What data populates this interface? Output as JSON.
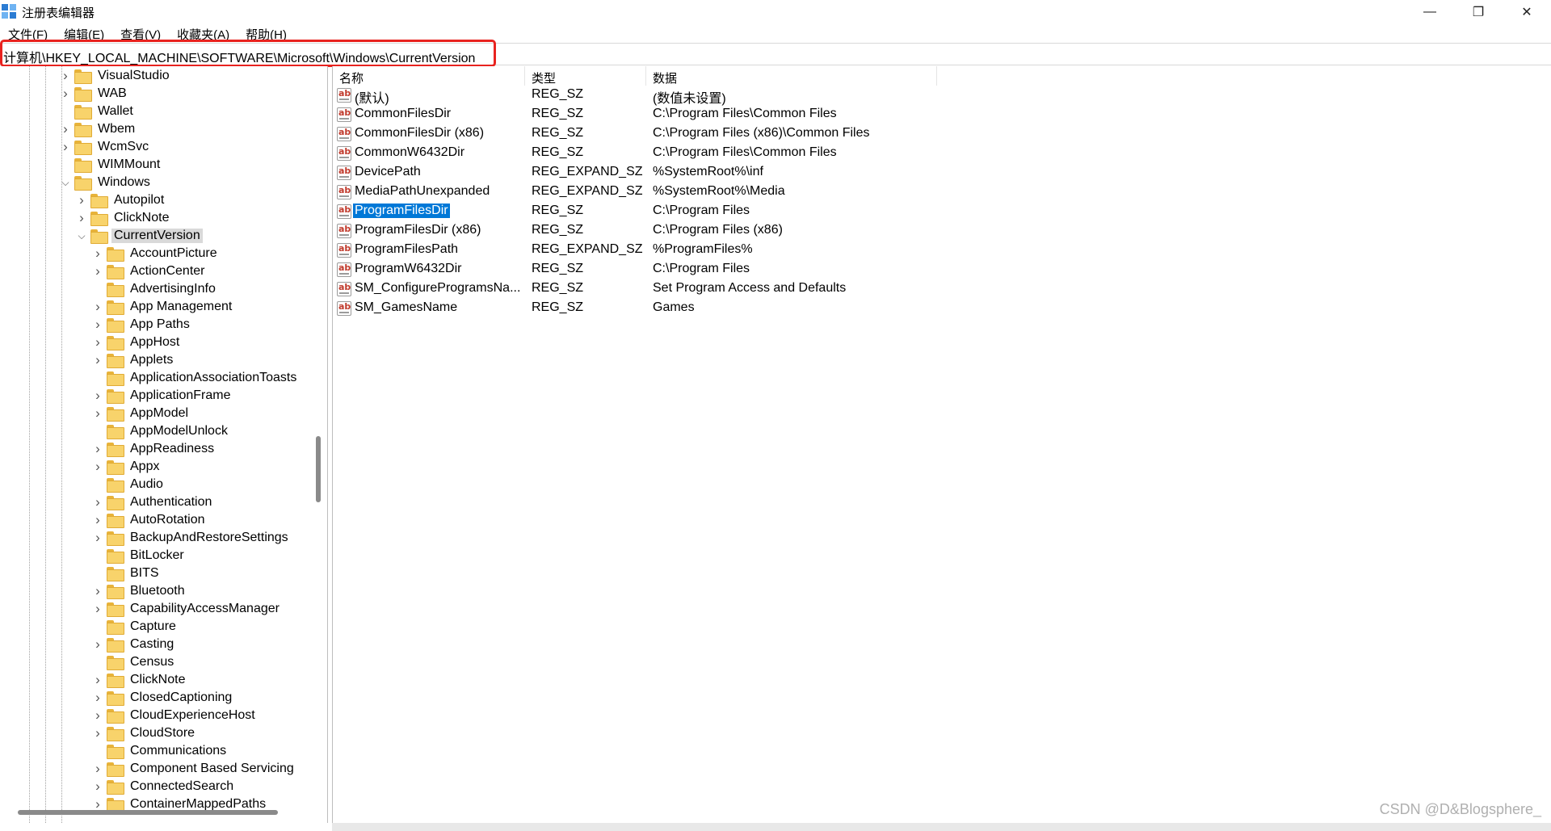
{
  "window": {
    "title": "注册表编辑器",
    "minimize_glyph": "—",
    "maximize_glyph": "❐",
    "close_glyph": "✕",
    "icon": "registry-editor-icon"
  },
  "menu": [
    "文件(F)",
    "编辑(E)",
    "查看(V)",
    "收藏夹(A)",
    "帮助(H)"
  ],
  "address": "计算机\\HKEY_LOCAL_MACHINE\\SOFTWARE\\Microsoft\\Windows\\CurrentVersion",
  "tree": {
    "level1": [
      {
        "label": "VisualStudio",
        "expandable": true
      },
      {
        "label": "WAB",
        "expandable": true
      },
      {
        "label": "Wallet",
        "expandable": false
      },
      {
        "label": "Wbem",
        "expandable": true
      },
      {
        "label": "WcmSvc",
        "expandable": true
      },
      {
        "label": "WIMMount",
        "expandable": false
      },
      {
        "label": "Windows",
        "expandable": true,
        "expanded": true
      }
    ],
    "level2": [
      {
        "label": "Autopilot",
        "expandable": true
      },
      {
        "label": "ClickNote",
        "expandable": true
      },
      {
        "label": "CurrentVersion",
        "expandable": true,
        "expanded": true,
        "selected": true
      }
    ],
    "level3": [
      {
        "label": "AccountPicture",
        "expandable": true
      },
      {
        "label": "ActionCenter",
        "expandable": true
      },
      {
        "label": "AdvertisingInfo",
        "expandable": false
      },
      {
        "label": "App Management",
        "expandable": true
      },
      {
        "label": "App Paths",
        "expandable": true
      },
      {
        "label": "AppHost",
        "expandable": true
      },
      {
        "label": "Applets",
        "expandable": true
      },
      {
        "label": "ApplicationAssociationToasts",
        "expandable": false
      },
      {
        "label": "ApplicationFrame",
        "expandable": true
      },
      {
        "label": "AppModel",
        "expandable": true
      },
      {
        "label": "AppModelUnlock",
        "expandable": false
      },
      {
        "label": "AppReadiness",
        "expandable": true
      },
      {
        "label": "Appx",
        "expandable": true
      },
      {
        "label": "Audio",
        "expandable": false
      },
      {
        "label": "Authentication",
        "expandable": true
      },
      {
        "label": "AutoRotation",
        "expandable": true
      },
      {
        "label": "BackupAndRestoreSettings",
        "expandable": true
      },
      {
        "label": "BitLocker",
        "expandable": false
      },
      {
        "label": "BITS",
        "expandable": false
      },
      {
        "label": "Bluetooth",
        "expandable": true
      },
      {
        "label": "CapabilityAccessManager",
        "expandable": true
      },
      {
        "label": "Capture",
        "expandable": false
      },
      {
        "label": "Casting",
        "expandable": true
      },
      {
        "label": "Census",
        "expandable": false
      },
      {
        "label": "ClickNote",
        "expandable": true
      },
      {
        "label": "ClosedCaptioning",
        "expandable": true
      },
      {
        "label": "CloudExperienceHost",
        "expandable": true
      },
      {
        "label": "CloudStore",
        "expandable": true
      },
      {
        "label": "Communications",
        "expandable": false
      },
      {
        "label": "Component Based Servicing",
        "expandable": true
      },
      {
        "label": "ConnectedSearch",
        "expandable": true
      },
      {
        "label": "ContainerMappedPaths",
        "expandable": true
      }
    ]
  },
  "columns": {
    "name": "名称",
    "type": "类型",
    "data": "数据"
  },
  "values": [
    {
      "name": "(默认)",
      "type": "REG_SZ",
      "data": "(数值未设置)"
    },
    {
      "name": "CommonFilesDir",
      "type": "REG_SZ",
      "data": "C:\\Program Files\\Common Files"
    },
    {
      "name": "CommonFilesDir (x86)",
      "type": "REG_SZ",
      "data": "C:\\Program Files (x86)\\Common Files"
    },
    {
      "name": "CommonW6432Dir",
      "type": "REG_SZ",
      "data": "C:\\Program Files\\Common Files"
    },
    {
      "name": "DevicePath",
      "type": "REG_EXPAND_SZ",
      "data": "%SystemRoot%\\inf"
    },
    {
      "name": "MediaPathUnexpanded",
      "type": "REG_EXPAND_SZ",
      "data": "%SystemRoot%\\Media"
    },
    {
      "name": "ProgramFilesDir",
      "type": "REG_SZ",
      "data": "C:\\Program Files",
      "selected": true
    },
    {
      "name": "ProgramFilesDir (x86)",
      "type": "REG_SZ",
      "data": "C:\\Program Files (x86)"
    },
    {
      "name": "ProgramFilesPath",
      "type": "REG_EXPAND_SZ",
      "data": "%ProgramFiles%"
    },
    {
      "name": "ProgramW6432Dir",
      "type": "REG_SZ",
      "data": "C:\\Program Files"
    },
    {
      "name": "SM_ConfigureProgramsNa...",
      "type": "REG_SZ",
      "data": "Set Program Access and Defaults"
    },
    {
      "name": "SM_GamesName",
      "type": "REG_SZ",
      "data": "Games"
    }
  ],
  "value_icon": "ab",
  "watermark": "CSDN @D&Blogsphere_",
  "colors": {
    "highlight_box": "#e8231f",
    "selection": "#0078d7",
    "folder": "#f8d36b"
  }
}
